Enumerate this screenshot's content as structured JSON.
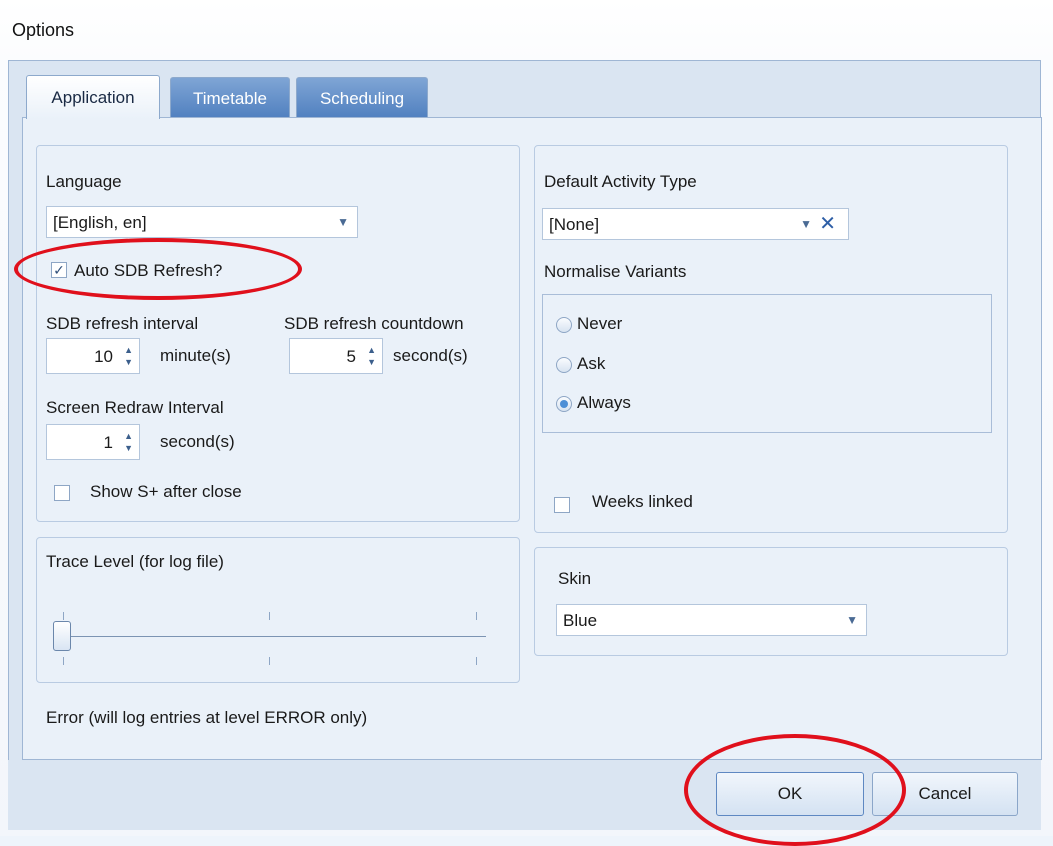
{
  "window": {
    "title": "Options"
  },
  "tabs": [
    {
      "label": "Application",
      "active": true
    },
    {
      "label": "Timetable",
      "active": false
    },
    {
      "label": "Scheduling",
      "active": false
    }
  ],
  "application": {
    "language": {
      "label": "Language",
      "value": "[English, en]"
    },
    "auto_sdb_refresh": {
      "label": "Auto SDB Refresh?",
      "checked": true
    },
    "sdb_refresh_interval": {
      "label": "SDB refresh interval",
      "value": "10",
      "unit": "minute(s)"
    },
    "sdb_refresh_countdown": {
      "label": "SDB refresh countdown",
      "value": "5",
      "unit": "second(s)"
    },
    "screen_redraw_interval": {
      "label": "Screen Redraw Interval",
      "value": "1",
      "unit": "second(s)"
    },
    "show_splus": {
      "label": "Show S+ after close",
      "checked": false
    },
    "default_activity_type": {
      "label": "Default Activity Type",
      "value": "[None]"
    },
    "normalise_variants": {
      "label": "Normalise Variants",
      "options": [
        "Never",
        "Ask",
        "Always"
      ],
      "selected": "Always"
    },
    "weeks_linked": {
      "label": "Weeks linked",
      "checked": false
    },
    "trace_level": {
      "label": "Trace Level (for log file)",
      "level": 0,
      "status": "Error (will log entries at level ERROR only)"
    },
    "skin": {
      "label": "Skin",
      "value": "Blue"
    }
  },
  "buttons": {
    "ok": "OK",
    "cancel": "Cancel"
  },
  "colors": {
    "highlight_ellipse": "#e0101c",
    "accent": "#4f7fbf"
  }
}
